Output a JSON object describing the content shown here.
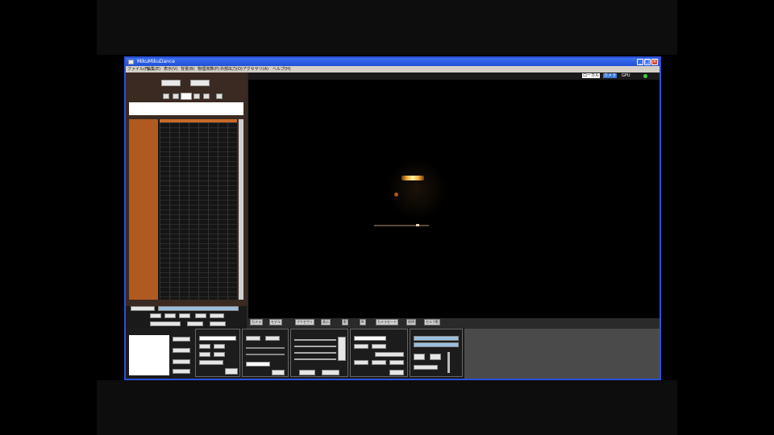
{
  "window": {
    "title": "MikuMikuDance",
    "min_glyph": "_",
    "max_glyph": "□",
    "close_glyph": "×"
  },
  "menu": {
    "items": [
      "ファイル(F)",
      "編集(E)",
      "表示(V)",
      "背景(B)",
      "物理演算(P)",
      "外部出力(O)",
      "アクセサリ(A)",
      "ヘルプ(H)"
    ]
  },
  "status": {
    "local": "ローカル",
    "camera": "カメラ",
    "gpu_label": "GPU"
  },
  "tabs": [
    "カメラ",
    "モデル",
    "アクセサリ",
    "表示",
    "影",
    "IK",
    "カメラモード",
    "照明",
    "セルフ影"
  ],
  "colors": {
    "window_border": "#2a52d8",
    "timeline_names": "#b05a22",
    "viewport": "#000000",
    "figure_glow": "#f0b040"
  }
}
